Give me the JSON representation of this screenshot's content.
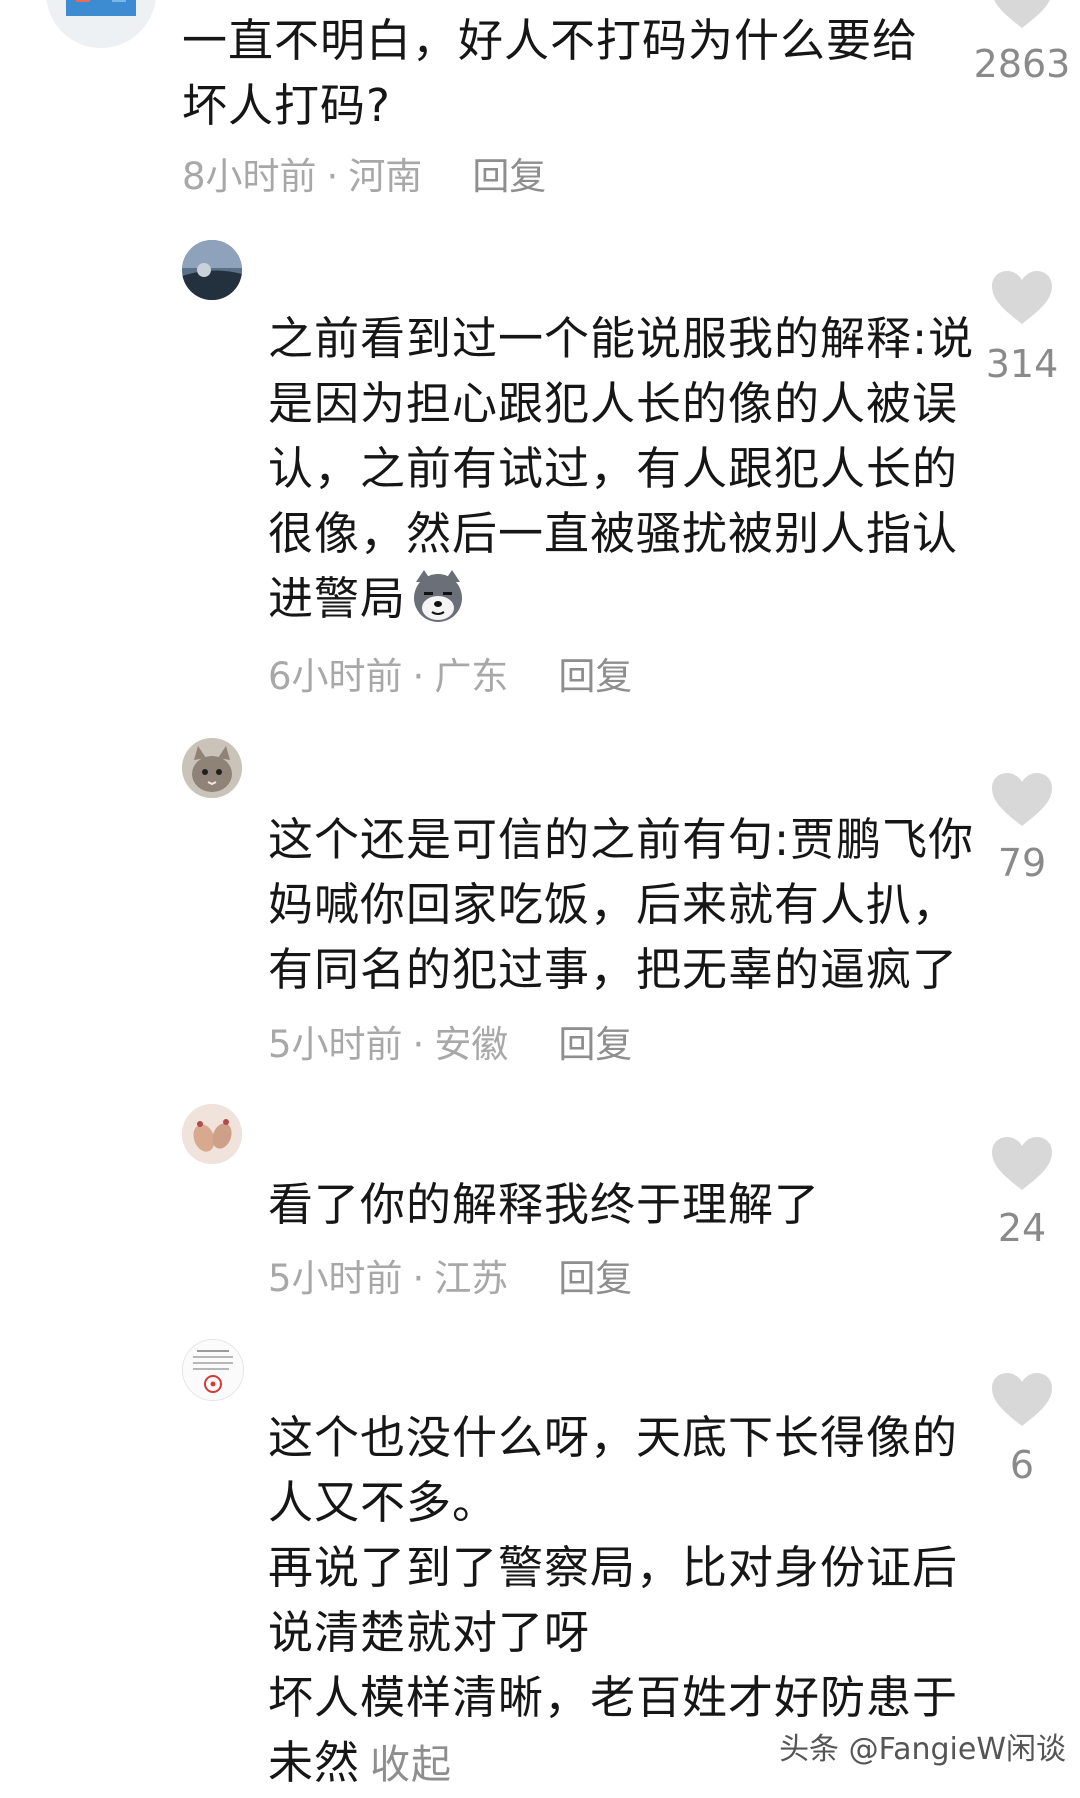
{
  "comments": [
    {
      "lines": [
        "一直不明白，好人不打码为什么要给",
        "坏人打码?"
      ],
      "time": "8小时前",
      "region": "河南",
      "reply_label": "回复",
      "likes": "2863"
    },
    {
      "lines": [
        "之前看到过一个能说服我的解释:说",
        "是因为担心跟犯人长的像的人被误",
        "认，之前有试过，有人跟犯人长的",
        "很像，然后一直被骚扰被别人指认",
        "进警局"
      ],
      "emoji": "dog-emoji",
      "time": "6小时前",
      "region": "广东",
      "reply_label": "回复",
      "likes": "314"
    },
    {
      "lines": [
        "这个还是可信的之前有句:贾鹏飞你",
        "妈喊你回家吃饭，后来就有人扒，",
        "有同名的犯过事，把无辜的逼疯了"
      ],
      "time": "5小时前",
      "region": "安徽",
      "reply_label": "回复",
      "likes": "79"
    },
    {
      "lines": [
        "看了你的解释我终于理解了"
      ],
      "time": "5小时前",
      "region": "江苏",
      "reply_label": "回复",
      "likes": "24"
    },
    {
      "lines": [
        "这个也没什么呀，天底下长得像的",
        "人又不多。",
        "再说了到了警察局，比对身份证后",
        "说清楚就对了呀",
        "坏人模样清晰，老百姓才好防患于",
        "未然"
      ],
      "collapse_label": "收起",
      "likes": "6"
    }
  ],
  "separator": "·",
  "watermark": "头条 @FangieW闲谈",
  "colors": {
    "text": "#161616",
    "meta": "#a8a8a8",
    "heart": "#d8d8d8",
    "count": "#8a8a8a"
  },
  "icons": [
    "heart-icon",
    "avatar",
    "dog-emoji"
  ]
}
